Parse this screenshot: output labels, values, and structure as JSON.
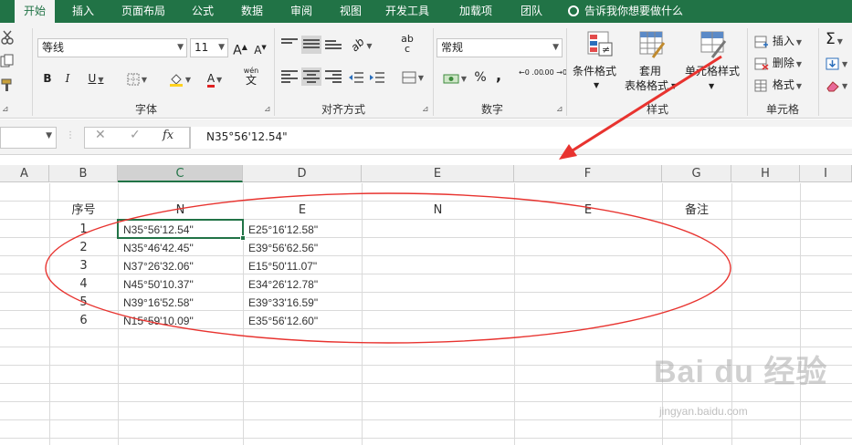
{
  "tabs": [
    {
      "label": "开始",
      "active": true
    },
    {
      "label": "插入"
    },
    {
      "label": "页面布局"
    },
    {
      "label": "公式"
    },
    {
      "label": "数据"
    },
    {
      "label": "审阅"
    },
    {
      "label": "视图"
    },
    {
      "label": "开发工具"
    },
    {
      "label": "加载项"
    },
    {
      "label": "团队"
    }
  ],
  "tell_me": "告诉我你想要做什么",
  "ribbon": {
    "font": {
      "name": "等线",
      "size": "11",
      "bold": "B",
      "italic": "I",
      "underline": "U",
      "grow": "A",
      "shrink": "A",
      "font_color": "A",
      "phonetic_top": "wén",
      "phonetic_bottom": "文",
      "label": "字体"
    },
    "alignment": {
      "wrap": "ab",
      "wrap2": "c",
      "label": "对齐方式"
    },
    "number": {
      "format": "常规",
      "percent": "%",
      "comma": ",",
      "inc_decimal": "←0 .00",
      "dec_decimal": ".00 →0",
      "label": "数字"
    },
    "styles": {
      "conditional": "条件格式",
      "table_line1": "套用",
      "table_line2": "表格格式",
      "cell_styles": "单元格样式",
      "label": "样式"
    },
    "cells": {
      "insert": "插入",
      "delete": "删除",
      "format": "格式",
      "label": "单元格"
    },
    "editing": {
      "sum": "Σ"
    }
  },
  "formula_bar": {
    "name_box": "",
    "cancel": "✕",
    "enter": "✓",
    "fx": "fx",
    "content": "N35°56'12.54\""
  },
  "columns": [
    "A",
    "B",
    "C",
    "D",
    "E",
    "F",
    "G",
    "H",
    "I"
  ],
  "selected_column": "C",
  "headers": {
    "seq": "序号",
    "n1": "N",
    "e1": "E",
    "n2": "N",
    "e2": "E",
    "note": "备注"
  },
  "rows": [
    {
      "seq": "1",
      "n": "N35°56'12.54\"",
      "e": "E25°16'12.58\""
    },
    {
      "seq": "2",
      "n": "N35°46'42.45\"",
      "e": "E39°56'62.56\""
    },
    {
      "seq": "3",
      "n": "N37°26'32.06\"",
      "e": "E15°50'11.07\""
    },
    {
      "seq": "4",
      "n": "N45°50'10.37\"",
      "e": "E34°26'12.78\""
    },
    {
      "seq": "5",
      "n": "N39°16'52.58\"",
      "e": "E39°33'16.59\""
    },
    {
      "seq": "6",
      "n": "N15°59'10.09\"",
      "e": "E35°56'12.60\""
    }
  ],
  "watermark": {
    "text": "Bai du 经验",
    "url": "jingyan.baidu.com"
  },
  "colors": {
    "excel_green": "#217346",
    "annotation_red": "#e8332f"
  }
}
